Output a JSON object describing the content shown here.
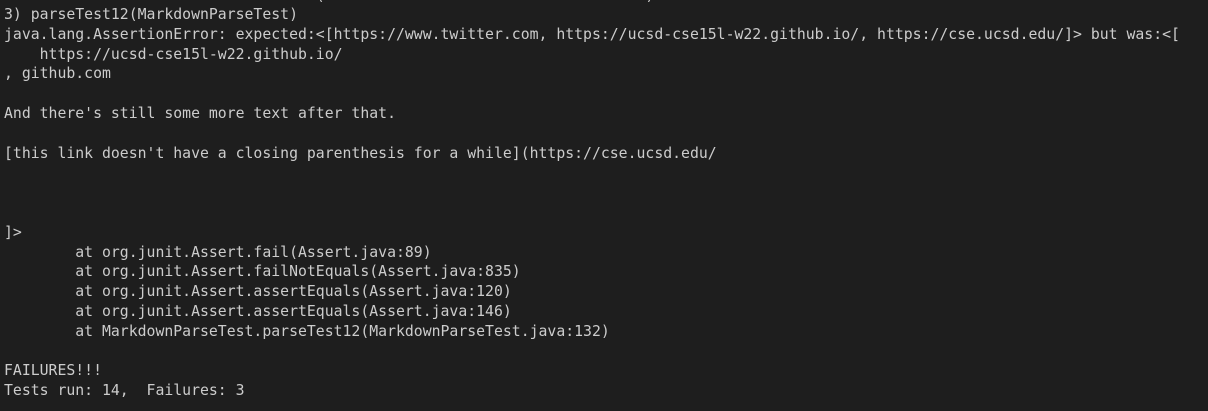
{
  "terminal": {
    "partial_top_line": "                                   (                                    )",
    "lines": [
      "3) parseTest12(MarkdownParseTest)",
      "java.lang.AssertionError: expected:<[https://www.twitter.com, https://ucsd-cse15l-w22.github.io/, https://cse.ucsd.edu/]> but was:<[",
      "    https://ucsd-cse15l-w22.github.io/",
      ", github.com",
      "",
      "And there's still some more text after that.",
      "",
      "[this link doesn't have a closing parenthesis for a while](https://cse.ucsd.edu/",
      "",
      "",
      "",
      "]>",
      "        at org.junit.Assert.fail(Assert.java:89)",
      "        at org.junit.Assert.failNotEquals(Assert.java:835)",
      "        at org.junit.Assert.assertEquals(Assert.java:120)",
      "        at org.junit.Assert.assertEquals(Assert.java:146)",
      "        at MarkdownParseTest.parseTest12(MarkdownParseTest.java:132)",
      "",
      "FAILURES!!!",
      "Tests run: 14,  Failures: 3"
    ]
  }
}
